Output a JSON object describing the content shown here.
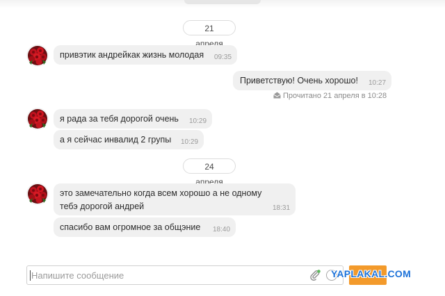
{
  "dates": [
    "21 апреля",
    "24 апреля"
  ],
  "messages": [
    {
      "lines": [
        "привэтик андрейкак жизнь молодая"
      ],
      "time": "09:35"
    },
    {
      "lines": [
        "Приветствую! Очень хорошо!"
      ],
      "time": "10:27"
    },
    {
      "lines": [
        "я рада за тебя дорогой очень"
      ],
      "time": "10:29"
    },
    {
      "lines": [
        "а я сейчас инвалид 2 групы"
      ],
      "time": "10:29"
    },
    {
      "lines": [
        "это замечательно когда всем хорошо а не одному",
        "тебэ дорогой андрей"
      ],
      "time": "18:31"
    },
    {
      "lines": [
        "спасибо вам огромное за общэние"
      ],
      "time": "18:40"
    }
  ],
  "read_receipt": "Прочитано 21 апреля в 10:28",
  "composer": {
    "placeholder": "Напишите сообщение"
  },
  "watermark": "YAPLAKAL.COM",
  "colors": {
    "bubble": "#f0f0f0",
    "send_button": "#f39a2b",
    "watermark": "#1e73d9"
  },
  "icons": {
    "avatar": "red-roses-avatar",
    "attach": "paperclip-icon",
    "read": "envelope-open-icon"
  }
}
